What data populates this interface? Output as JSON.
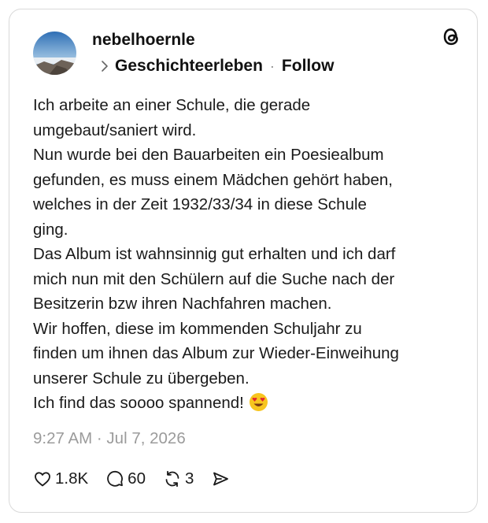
{
  "post": {
    "username": "nebelhoernle",
    "topic": "Geschichteerleben",
    "separator": "·",
    "follow_label": "Follow",
    "body_lines": [
      "Ich arbeite an einer Schule, die gerade",
      "umgebaut/saniert wird.",
      "Nun wurde bei den Bauarbeiten ein Poesiealbum",
      "gefunden, es muss einem Mädchen gehört haben,",
      "welches in der Zeit 1932/33/34 in diese Schule",
      "ging.",
      "Das Album ist wahnsinnig gut erhalten und ich darf",
      "mich nun mit den Schülern auf die Suche nach der",
      "Besitzerin bzw ihren Nachfahren machen.",
      "Wir hoffen, diese im kommenden Schuljahr zu",
      "finden um ihnen das Album zur Wieder-Einweihung",
      "unserer Schule zu übergeben.",
      "Ich find das soooo spannend!"
    ],
    "emoji_icon": "heart-eyes-emoji",
    "timestamp": "9:27 AM · Jul 7, 2026"
  },
  "actions": {
    "likes": "1.8K",
    "comments": "60",
    "reposts": "3"
  },
  "icons": {
    "brand": "threads-logo-icon",
    "like": "heart-icon",
    "comment": "comment-bubble-icon",
    "repost": "repost-icon",
    "share": "send-icon"
  }
}
